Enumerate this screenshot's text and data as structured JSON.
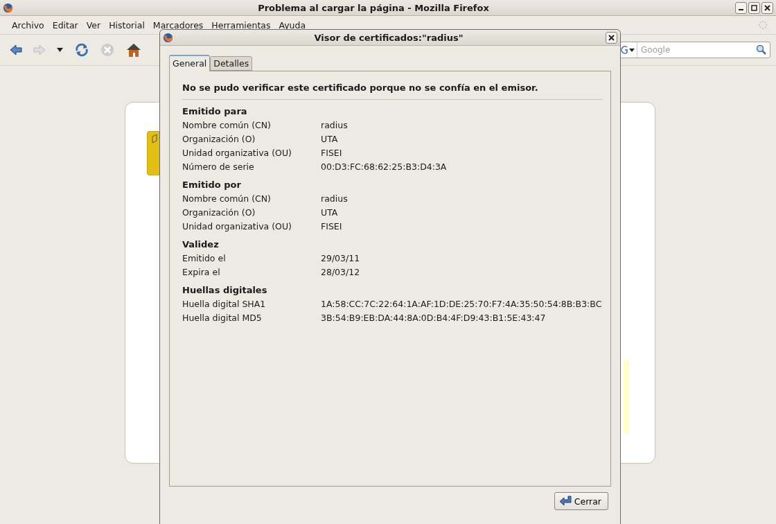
{
  "window": {
    "title": "Problema al cargar la página - Mozilla Firefox"
  },
  "menu": [
    "Archivo",
    "Editar",
    "Ver",
    "Historial",
    "Marcadores",
    "Herramientas",
    "Ayuda"
  ],
  "search": {
    "placeholder": "Google"
  },
  "dialog": {
    "title": "Visor de certificados:\"radius\"",
    "tabs": [
      {
        "label": "General",
        "selected": true
      },
      {
        "label": "Detalles",
        "selected": false
      }
    ],
    "warning": "No se pudo verificar este certificado porque no se confía en el emisor.",
    "sections": [
      {
        "heading": "Emitido para",
        "rows": [
          [
            "Nombre común (CN)",
            "radius"
          ],
          [
            "Organización (O)",
            "UTA"
          ],
          [
            "Unidad organizativa (OU)",
            "FISEI"
          ],
          [
            "Número de serie",
            "00:D3:FC:68:62:25:B3:D4:3A"
          ]
        ]
      },
      {
        "heading": "Emitido por",
        "rows": [
          [
            "Nombre común (CN)",
            "radius"
          ],
          [
            "Organización (O)",
            "UTA"
          ],
          [
            "Unidad organizativa (OU)",
            "FISEI"
          ]
        ]
      },
      {
        "heading": "Validez",
        "rows": [
          [
            "Emitido el",
            "29/03/11"
          ],
          [
            "Expira el",
            "28/03/12"
          ]
        ]
      },
      {
        "heading": "Huellas digitales",
        "rows": [
          [
            "Huella digital SHA1",
            "1A:58:CC:7C:22:64:1A:AF:1D:DE:25:70:F7:4A:35:50:54:8B:B3:BC"
          ],
          [
            "Huella digital MD5",
            "3B:54:B9:EB:DA:44:8A:0D:B4:4F:D9:43:B1:5E:43:47"
          ]
        ]
      }
    ],
    "button": "Cerrar"
  }
}
